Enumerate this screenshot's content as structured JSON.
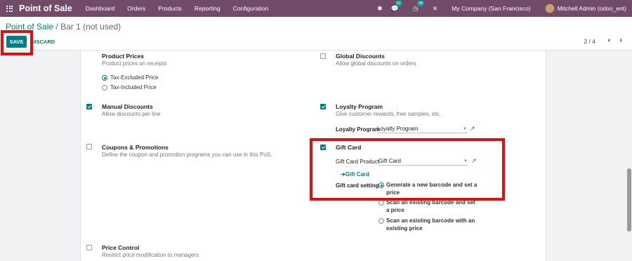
{
  "navbar": {
    "app_title": "Point of Sale",
    "menu": [
      "Dashboard",
      "Orders",
      "Products",
      "Reporting",
      "Configuration"
    ],
    "messages_count": "22",
    "activities_count": "38",
    "company": "My Company (San Francisco)",
    "user": "Mitchell Admin (odoo_ent)"
  },
  "breadcrumb": {
    "parent": "Point of Sale",
    "separator": " / ",
    "current": "Bar 1 (not used)"
  },
  "buttons": {
    "save": "SAVE",
    "discard": "DISCARD"
  },
  "pager": {
    "value": "2 / 4",
    "prev": "‹",
    "next": "›"
  },
  "settings": {
    "product_prices": {
      "title": "Product Prices",
      "desc": "Product prices on receipts",
      "options": [
        "Tax-Excluded Price",
        "Tax-Included Price"
      ],
      "selected": "Tax-Excluded Price"
    },
    "global_discounts": {
      "title": "Global Discounts",
      "desc": "Allow global discounts on orders",
      "checked": false
    },
    "manual_discounts": {
      "title": "Manual Discounts",
      "desc": "Allow discounts per line",
      "checked": true
    },
    "loyalty_program": {
      "title": "Loyalty Program",
      "desc": "Give customer rewards, free samples, etc.",
      "checked": true,
      "field_label": "Loyalty Program",
      "field_value": "Loyalty Program"
    },
    "coupons": {
      "title": "Coupons & Promotions",
      "desc": "Define the coupon and promotion programs you can use in this PoS.",
      "checked": false
    },
    "gift_card": {
      "title": "Gift Card",
      "checked": true,
      "product_label": "Gift Card Product",
      "product_value": "Gift Card",
      "link": "Gift Card",
      "settings_label": "Gift card settings",
      "options": [
        "Generate a new barcode and set a price",
        "Scan an existing barcode and set a price",
        "Scan an existing barcode with an existing price"
      ],
      "selected": "Generate a new barcode and set a price"
    },
    "price_control": {
      "title": "Price Control",
      "desc": "Restrict price modification to managers",
      "checked": false
    }
  },
  "colors": {
    "navbar": "#714b67",
    "primary": "#017e84",
    "highlight": "#e30f0f"
  },
  "icons": [
    "apps-grid-icon",
    "bug-icon",
    "chat-icon",
    "clock-icon",
    "tools-icon",
    "external-link-icon",
    "arrow-right-icon",
    "chevron-left-icon",
    "chevron-right-icon",
    "caret-down-icon"
  ]
}
